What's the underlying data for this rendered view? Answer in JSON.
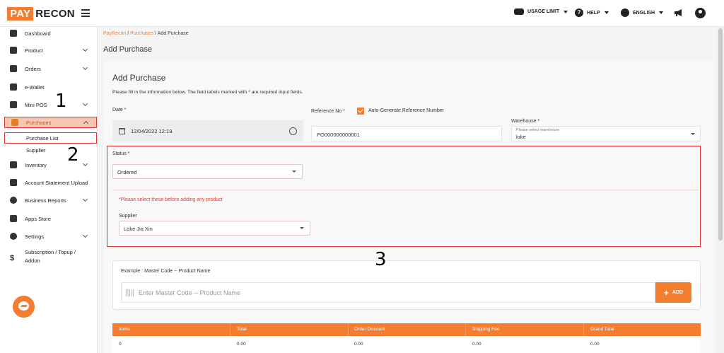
{
  "brand": {
    "logo_pay": "PAY",
    "logo_recon": "RECON"
  },
  "topbar": {
    "usage_limit": "USAGE LIMIT",
    "help": "HELP",
    "language": "ENGLISH"
  },
  "sidebar": {
    "items": [
      {
        "label": "Dashboard"
      },
      {
        "label": "Product"
      },
      {
        "label": "Orders"
      },
      {
        "label": "e-Wallet"
      },
      {
        "label": "Mini POS"
      },
      {
        "label": "Purchases"
      },
      {
        "label": "Inventory"
      },
      {
        "label": "Account Statement Upload"
      },
      {
        "label": "Business Reports"
      },
      {
        "label": "Apps Store"
      },
      {
        "label": "Settings"
      },
      {
        "label": "Subscription / Topup /"
      },
      {
        "label": "Addon"
      }
    ],
    "sub_items": [
      {
        "label": "Purchase List"
      },
      {
        "label": "Supplier"
      }
    ]
  },
  "breadcrumb": {
    "root": "PayRecon",
    "parent": "Purchases",
    "current": "Add Purchase",
    "sep": "/"
  },
  "page_title": "Add Purchase",
  "form": {
    "title": "Add Purchase",
    "hint": "Please fill in the information below. The field labels marked with * are required input fields.",
    "date_label": "Date *",
    "date_value": "12/04/2022 12:19",
    "reference_label": "Reference No *",
    "auto_generate_label": "Auto-Generate Reference Number",
    "reference_value": "PO000000000001",
    "warehouse_label": "Warehouse *",
    "warehouse_placeholder": "Please select warehouse",
    "warehouse_value": "loke",
    "status_label": "Status *",
    "status_value": "Ordered",
    "warning": "*Please select these before adding any product",
    "supplier_label": "Supplier",
    "supplier_value": "Loke Jia Xin"
  },
  "product_search": {
    "example": "Example : Master Code -- Product Name",
    "placeholder": "Enter Master Code -- Product Name",
    "add_label": "ADD"
  },
  "table": {
    "headers": [
      "Items",
      "Total",
      "Order Discount",
      "Shipping Fee",
      "Grand Total"
    ],
    "row": [
      "0",
      "0.00",
      "0.00",
      "0.00",
      "0.00"
    ]
  },
  "annotations": {
    "one": "1",
    "two": "2",
    "three": "3"
  },
  "colors": {
    "accent": "#f47d30",
    "highlight": "#e03030"
  }
}
